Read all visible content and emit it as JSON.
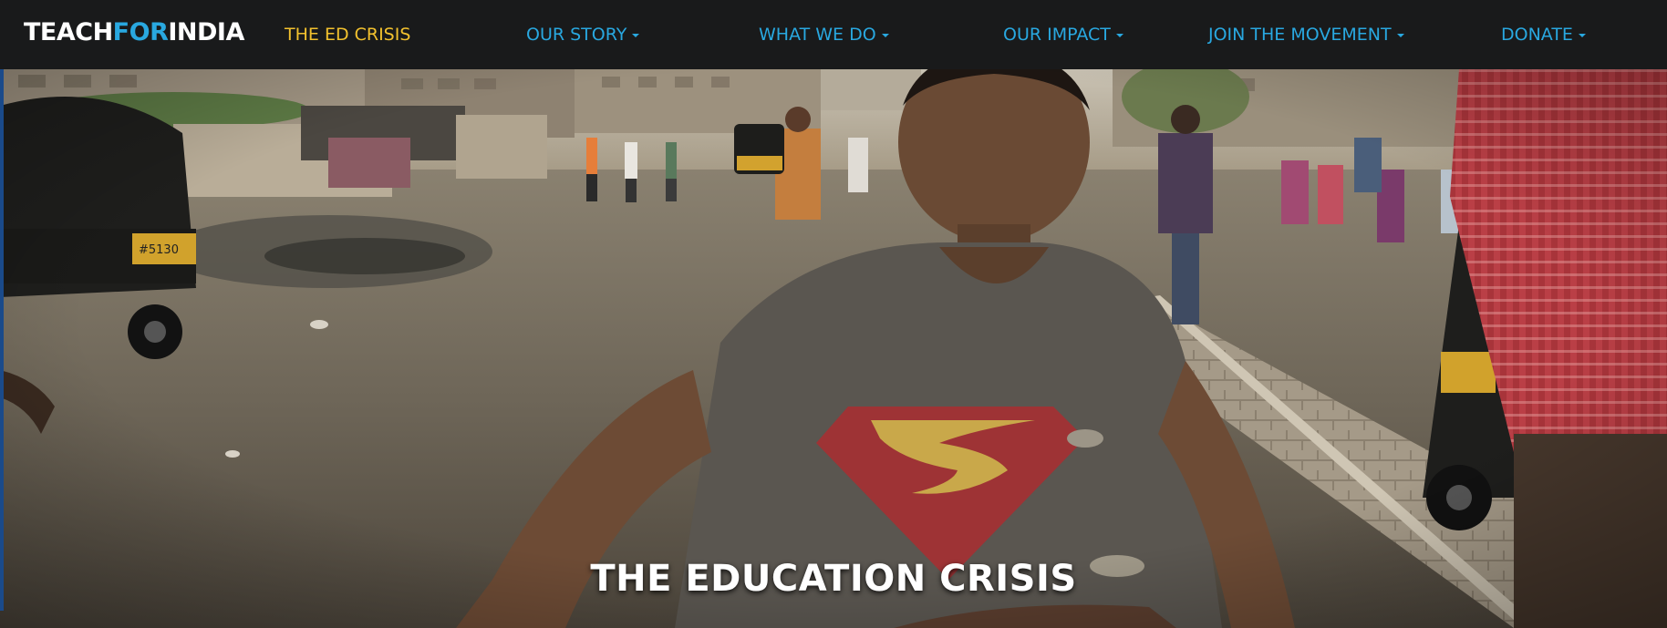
{
  "brand": {
    "logo_part1": "TEACH",
    "logo_part2": "FOR",
    "logo_part3": "INDIA"
  },
  "nav": {
    "items": [
      {
        "label": "THE ED CRISIS",
        "active": true
      },
      {
        "label": "OUR STORY",
        "dropdown": true
      },
      {
        "label": "WHAT WE DO",
        "dropdown": true
      },
      {
        "label": "OUR IMPACT",
        "dropdown": true
      },
      {
        "label": "JOIN THE MOVEMENT",
        "dropdown": true
      },
      {
        "label": "DONATE",
        "dropdown": true
      }
    ]
  },
  "hero": {
    "title": "THE EDUCATION CRISIS"
  },
  "colors": {
    "nav_bg": "#191a1b",
    "link": "#29a8e0",
    "active": "#f2c12e",
    "logo_accent": "#29a8e0"
  }
}
